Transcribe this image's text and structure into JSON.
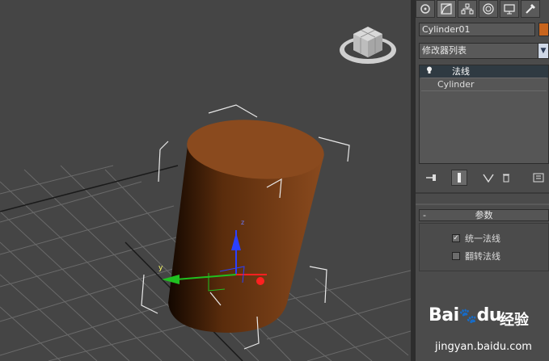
{
  "viewport": {
    "axis_y_label": "y",
    "axis_z_label": "z",
    "viewcube_icon": "viewcube-icon",
    "object_color": "#8a4a1e"
  },
  "panel": {
    "tabs": [
      {
        "icon": "create-icon"
      },
      {
        "icon": "modify-icon"
      },
      {
        "icon": "hierarchy-icon"
      },
      {
        "icon": "motion-icon"
      },
      {
        "icon": "display-icon"
      },
      {
        "icon": "utilities-icon"
      }
    ],
    "object_name": "Cylinder01",
    "object_color": "#c8651e",
    "modifier_list_label": "修改器列表",
    "stack": {
      "items": [
        {
          "label": "法线",
          "selected": true,
          "icon": "lightbulb-icon"
        },
        {
          "label": "Cylinder",
          "selected": false
        }
      ]
    },
    "rollout": {
      "title": "参数",
      "collapse_symbol": "-",
      "options": [
        {
          "label": "统一法线",
          "checked": true
        },
        {
          "label": "翻转法线",
          "checked": false
        }
      ]
    }
  },
  "watermark": {
    "logo": "Bai",
    "logo_suffix": "du",
    "cn": "经验",
    "url": "jingyan.baidu.com"
  }
}
